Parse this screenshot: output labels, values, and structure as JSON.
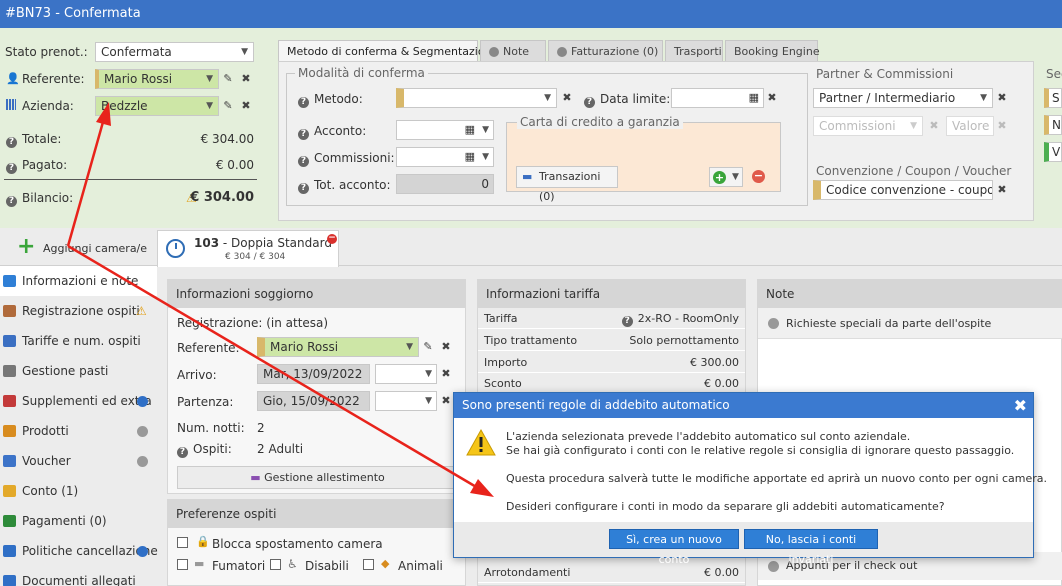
{
  "window": {
    "title": "#BN73 - Confermata"
  },
  "booking": {
    "stato_label": "Stato prenot.:",
    "stato_value": "Confermata",
    "referente_label": "Referente:",
    "referente_value": "Mario Rossi",
    "azienda_label": "Azienda:",
    "azienda_value": "Bedzzle",
    "totale_label": "Totale:",
    "totale_value": "€ 304.00",
    "pagato_label": "Pagato:",
    "pagato_value": "€ 0.00",
    "bilancio_label": "Bilancio:",
    "bilancio_value": "€ 304.00"
  },
  "tabs": [
    "Metodo di conferma & Segmentazione",
    "Note",
    "Fatturazione (0)",
    "Trasporti",
    "Booking Engine"
  ],
  "conferma": {
    "legend": "Modalità di conferma",
    "metodo_label": "Metodo:",
    "data_limite_label": "Data limite:",
    "acconto_label": "Acconto:",
    "commissioni_label": "Commissioni:",
    "tot_acconto_label": "Tot. acconto:",
    "tot_acconto_value": "0",
    "carta_legend": "Carta di credito a garanzia",
    "transazioni_label": "Transazioni (0)"
  },
  "partner": {
    "title": "Partner & Commissioni",
    "select_value": "Partner / Intermediario",
    "commissioni_placeholder": "Commissioni",
    "valore_placeholder": "Valore",
    "convenzione_title": "Convenzione / Coupon / Voucher",
    "codice_value": "Codice convenzione - coupon",
    "seg_title": "Seg",
    "seg_items": [
      "S",
      "N",
      "V"
    ]
  },
  "rooms": {
    "add_label": "Aggiungi camera/e",
    "room_number": "103",
    "room_name": " - Doppia Standard",
    "room_price": "€ 304 / € 304"
  },
  "sidebar": {
    "items": [
      {
        "label": "Informazioni e note",
        "icon": "info-icon",
        "color": "#2f7fd6"
      },
      {
        "label": "Registrazione ospiti",
        "icon": "guest-icon",
        "color": "#b06a3b"
      },
      {
        "label": "Tariffe e num. ospiti",
        "icon": "tariff-icon",
        "color": "#3b6fc2"
      },
      {
        "label": "Gestione pasti",
        "icon": "meal-icon",
        "color": "#777777"
      },
      {
        "label": "Supplementi ed extra",
        "icon": "extra-icon",
        "color": "#c33a3a"
      },
      {
        "label": "Prodotti",
        "icon": "product-icon",
        "color": "#d88c1f"
      },
      {
        "label": "Voucher",
        "icon": "voucher-icon",
        "color": "#3c73c8"
      },
      {
        "label": "Conto (1)",
        "icon": "folder-icon",
        "color": "#e3a92a"
      },
      {
        "label": "Pagamenti (0)",
        "icon": "payment-icon",
        "color": "#2e8b3a"
      },
      {
        "label": "Politiche cancellazione",
        "icon": "policy-icon",
        "color": "#2f6fc6"
      },
      {
        "label": "Documenti allegati",
        "icon": "document-icon",
        "color": "#2f6fc6"
      }
    ]
  },
  "soggiorno": {
    "title": "Informazioni soggiorno",
    "registrazione_label": "Registrazione:",
    "registrazione_value": "(in attesa)",
    "referente_label": "Referente:",
    "referente_value": "Mario Rossi",
    "arrivo_label": "Arrivo:",
    "arrivo_value": "Mar, 13/09/2022",
    "partenza_label": "Partenza:",
    "partenza_value": "Gio, 15/09/2022",
    "notti_label": "Num. notti:",
    "notti_value": "2",
    "ospiti_label": "Ospiti:",
    "ospiti_value": "2 Adulti",
    "allestimento_label": "Gestione allestimento"
  },
  "preferenze": {
    "title": "Preferenze ospiti",
    "blocca": "Blocca spostamento camera",
    "fumatori": "Fumatori",
    "disabili": "Disabili",
    "animali": "Animali"
  },
  "tariffa": {
    "title": "Informazioni tariffa",
    "rows": [
      {
        "label": "Tariffa",
        "value": "2x-RO - RoomOnly"
      },
      {
        "label": "Tipo trattamento",
        "value": "Solo pernottamento"
      },
      {
        "label": "Importo",
        "value": "€ 300.00"
      },
      {
        "label": "Sconto",
        "value": "€ 0.00"
      }
    ],
    "arrotondamenti_label": "Arrotondamenti",
    "arrotondamenti_value": "€ 0.00"
  },
  "note": {
    "title": "Note",
    "richieste": "Richieste speciali da parte dell'ospite",
    "checkout": "Appunti per il check out"
  },
  "dialog": {
    "title": "Sono presenti regole di addebito automatico",
    "line1": "L'azienda selezionata prevede l'addebito automatico sul conto aziendale.",
    "line2": "Se hai già configurato i conti con le relative regole si consiglia di ignorare questo passaggio.",
    "line3": "Questa procedura salverà tutte le modifiche apportate ed aprirà un nuovo conto per ogni camera.",
    "line4": "Desideri configurare i conti in modo da separare gli addebiti automaticamente?",
    "yes_button": "Sì, crea un nuovo conto",
    "no_button": "No, lascia i conti invariati"
  },
  "colors": {
    "titlebar": "#3b73c6",
    "accent": "#2f7fd6",
    "annotation": "#e8231b"
  }
}
